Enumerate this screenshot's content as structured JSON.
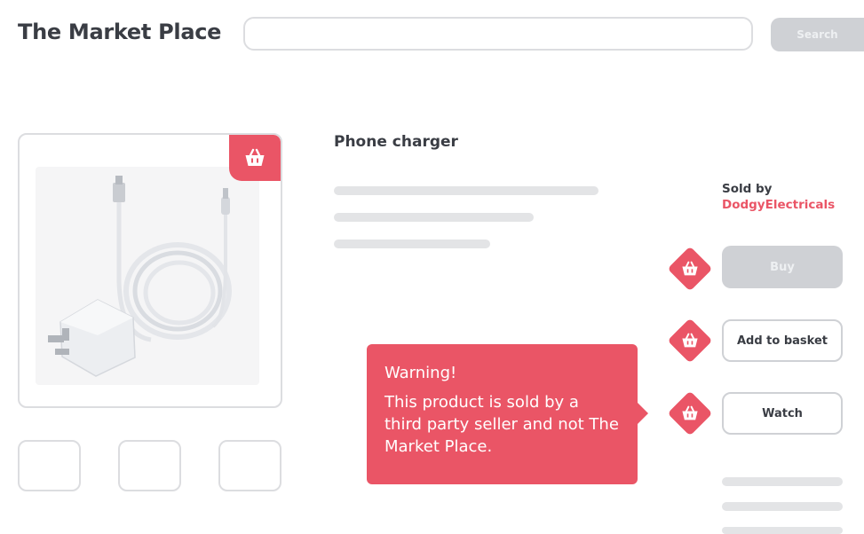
{
  "header": {
    "brand": "The Market Place",
    "search_placeholder": "",
    "search_button": "Search"
  },
  "product": {
    "title": "Phone charger",
    "sold_by_label": "Sold by",
    "seller": "DodgyElectricals"
  },
  "actions": {
    "buy": "Buy",
    "add_to_basket": "Add to basket",
    "watch": "Watch"
  },
  "warning": {
    "title": "Warning!",
    "body": "This product is sold by a third party seller and not The Market Place."
  },
  "colors": {
    "accent": "#ea5566",
    "text": "#3a3d44",
    "disabled": "#cfd1d5",
    "skeleton": "#e3e4e6"
  },
  "icons": {
    "basket": "basket-icon",
    "product_image": "phone-charger-image"
  }
}
